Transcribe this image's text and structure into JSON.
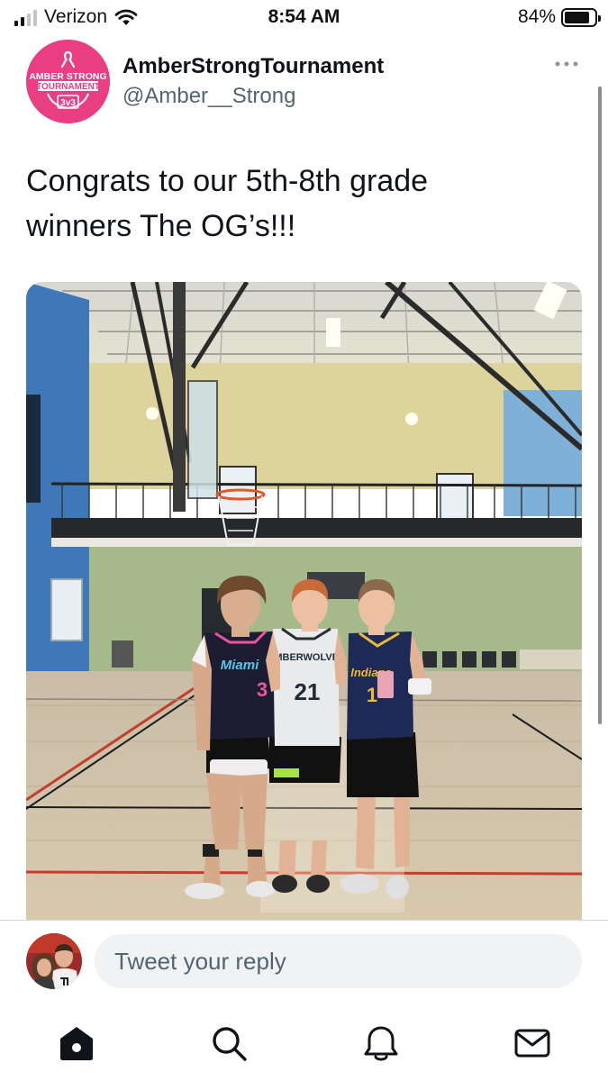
{
  "status_bar": {
    "carrier": "Verizon",
    "time": "8:54 AM",
    "battery_percent": "84%",
    "battery_level": 0.84,
    "signal_bars": 2,
    "signal_icon": "cellular-signal-icon",
    "wifi_icon": "wifi-icon",
    "battery_icon": "battery-icon"
  },
  "tweet": {
    "display_name": "AmberStrongTournament",
    "handle": "@Amber__Strong",
    "text_line1": "Congrats to our 5th-8th grade",
    "text_line2": "winners The OG’s!!!",
    "avatar": {
      "line1": "AMBER STRONG",
      "line2": "TOURNAMENT",
      "line3": "3v3",
      "color": "#ea3e84"
    },
    "more_icon": "more-icon",
    "photo": {
      "jersey_left": "Miami",
      "jersey_left_number": "3",
      "jersey_middle": "TIMBERWOLVES",
      "jersey_middle_number": "21",
      "jersey_right": "Indiana",
      "jersey_right_number": "1"
    }
  },
  "reply": {
    "placeholder": "Tweet your reply"
  },
  "tab_bar": {
    "items": [
      {
        "name": "home-icon"
      },
      {
        "name": "search-icon"
      },
      {
        "name": "notifications-icon"
      },
      {
        "name": "messages-icon"
      }
    ]
  },
  "colors": {
    "text_primary": "#0f1419",
    "text_secondary": "#536471",
    "reply_field": "#eff3f4",
    "brand_pink": "#ea3e84"
  }
}
